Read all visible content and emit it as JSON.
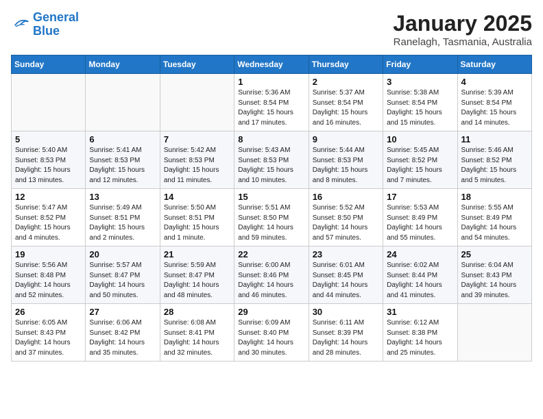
{
  "header": {
    "logo_line1": "General",
    "logo_line2": "Blue",
    "month": "January 2025",
    "location": "Ranelagh, Tasmania, Australia"
  },
  "days_of_week": [
    "Sunday",
    "Monday",
    "Tuesday",
    "Wednesday",
    "Thursday",
    "Friday",
    "Saturday"
  ],
  "weeks": [
    [
      {
        "day": "",
        "info": ""
      },
      {
        "day": "",
        "info": ""
      },
      {
        "day": "",
        "info": ""
      },
      {
        "day": "1",
        "info": "Sunrise: 5:36 AM\nSunset: 8:54 PM\nDaylight: 15 hours\nand 17 minutes."
      },
      {
        "day": "2",
        "info": "Sunrise: 5:37 AM\nSunset: 8:54 PM\nDaylight: 15 hours\nand 16 minutes."
      },
      {
        "day": "3",
        "info": "Sunrise: 5:38 AM\nSunset: 8:54 PM\nDaylight: 15 hours\nand 15 minutes."
      },
      {
        "day": "4",
        "info": "Sunrise: 5:39 AM\nSunset: 8:54 PM\nDaylight: 15 hours\nand 14 minutes."
      }
    ],
    [
      {
        "day": "5",
        "info": "Sunrise: 5:40 AM\nSunset: 8:53 PM\nDaylight: 15 hours\nand 13 minutes."
      },
      {
        "day": "6",
        "info": "Sunrise: 5:41 AM\nSunset: 8:53 PM\nDaylight: 15 hours\nand 12 minutes."
      },
      {
        "day": "7",
        "info": "Sunrise: 5:42 AM\nSunset: 8:53 PM\nDaylight: 15 hours\nand 11 minutes."
      },
      {
        "day": "8",
        "info": "Sunrise: 5:43 AM\nSunset: 8:53 PM\nDaylight: 15 hours\nand 10 minutes."
      },
      {
        "day": "9",
        "info": "Sunrise: 5:44 AM\nSunset: 8:53 PM\nDaylight: 15 hours\nand 8 minutes."
      },
      {
        "day": "10",
        "info": "Sunrise: 5:45 AM\nSunset: 8:52 PM\nDaylight: 15 hours\nand 7 minutes."
      },
      {
        "day": "11",
        "info": "Sunrise: 5:46 AM\nSunset: 8:52 PM\nDaylight: 15 hours\nand 5 minutes."
      }
    ],
    [
      {
        "day": "12",
        "info": "Sunrise: 5:47 AM\nSunset: 8:52 PM\nDaylight: 15 hours\nand 4 minutes."
      },
      {
        "day": "13",
        "info": "Sunrise: 5:49 AM\nSunset: 8:51 PM\nDaylight: 15 hours\nand 2 minutes."
      },
      {
        "day": "14",
        "info": "Sunrise: 5:50 AM\nSunset: 8:51 PM\nDaylight: 15 hours\nand 1 minute."
      },
      {
        "day": "15",
        "info": "Sunrise: 5:51 AM\nSunset: 8:50 PM\nDaylight: 14 hours\nand 59 minutes."
      },
      {
        "day": "16",
        "info": "Sunrise: 5:52 AM\nSunset: 8:50 PM\nDaylight: 14 hours\nand 57 minutes."
      },
      {
        "day": "17",
        "info": "Sunrise: 5:53 AM\nSunset: 8:49 PM\nDaylight: 14 hours\nand 55 minutes."
      },
      {
        "day": "18",
        "info": "Sunrise: 5:55 AM\nSunset: 8:49 PM\nDaylight: 14 hours\nand 54 minutes."
      }
    ],
    [
      {
        "day": "19",
        "info": "Sunrise: 5:56 AM\nSunset: 8:48 PM\nDaylight: 14 hours\nand 52 minutes."
      },
      {
        "day": "20",
        "info": "Sunrise: 5:57 AM\nSunset: 8:47 PM\nDaylight: 14 hours\nand 50 minutes."
      },
      {
        "day": "21",
        "info": "Sunrise: 5:59 AM\nSunset: 8:47 PM\nDaylight: 14 hours\nand 48 minutes."
      },
      {
        "day": "22",
        "info": "Sunrise: 6:00 AM\nSunset: 8:46 PM\nDaylight: 14 hours\nand 46 minutes."
      },
      {
        "day": "23",
        "info": "Sunrise: 6:01 AM\nSunset: 8:45 PM\nDaylight: 14 hours\nand 44 minutes."
      },
      {
        "day": "24",
        "info": "Sunrise: 6:02 AM\nSunset: 8:44 PM\nDaylight: 14 hours\nand 41 minutes."
      },
      {
        "day": "25",
        "info": "Sunrise: 6:04 AM\nSunset: 8:43 PM\nDaylight: 14 hours\nand 39 minutes."
      }
    ],
    [
      {
        "day": "26",
        "info": "Sunrise: 6:05 AM\nSunset: 8:43 PM\nDaylight: 14 hours\nand 37 minutes."
      },
      {
        "day": "27",
        "info": "Sunrise: 6:06 AM\nSunset: 8:42 PM\nDaylight: 14 hours\nand 35 minutes."
      },
      {
        "day": "28",
        "info": "Sunrise: 6:08 AM\nSunset: 8:41 PM\nDaylight: 14 hours\nand 32 minutes."
      },
      {
        "day": "29",
        "info": "Sunrise: 6:09 AM\nSunset: 8:40 PM\nDaylight: 14 hours\nand 30 minutes."
      },
      {
        "day": "30",
        "info": "Sunrise: 6:11 AM\nSunset: 8:39 PM\nDaylight: 14 hours\nand 28 minutes."
      },
      {
        "day": "31",
        "info": "Sunrise: 6:12 AM\nSunset: 8:38 PM\nDaylight: 14 hours\nand 25 minutes."
      },
      {
        "day": "",
        "info": ""
      }
    ]
  ]
}
